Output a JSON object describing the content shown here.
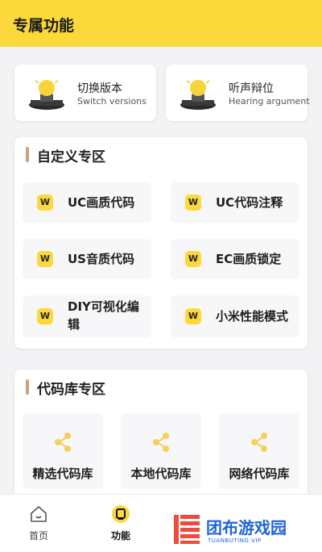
{
  "header": {
    "title": "专属功能",
    "bg_color": "#fbd93a"
  },
  "top_cards": [
    {
      "title": "切换版本",
      "subtitle": "Switch versions",
      "icon": "lamp-icon"
    },
    {
      "title": "听声辩位",
      "subtitle": "Hearing argument",
      "icon": "lamp-icon"
    }
  ],
  "custom_section": {
    "title": "自定义专区",
    "items": [
      {
        "label": "UC画质代码",
        "badge": "W"
      },
      {
        "label": "UC代码注释",
        "badge": "W"
      },
      {
        "label": "US音质代码",
        "badge": "W"
      },
      {
        "label": "EC画质锁定",
        "badge": "W"
      },
      {
        "label": "DIY可视化编辑",
        "badge": "W"
      },
      {
        "label": "小米性能模式",
        "badge": "W"
      }
    ]
  },
  "library_section": {
    "title": "代码库专区",
    "items": [
      {
        "label": "精选代码库",
        "icon": "share-icon"
      },
      {
        "label": "本地代码库",
        "icon": "share-icon"
      },
      {
        "label": "网络代码库",
        "icon": "share-icon"
      }
    ]
  },
  "tabbar": {
    "tabs": [
      {
        "label": "首页",
        "icon": "home-icon",
        "active": false
      },
      {
        "label": "功能",
        "icon": "function-icon",
        "active": true
      }
    ]
  },
  "watermark": {
    "text": "团布游戏园",
    "subtext": "TUANBUTING.VIP"
  },
  "colors": {
    "accent": "#fbd93a",
    "section_bar": "#caa37e",
    "watermark": "#1f63d8"
  }
}
